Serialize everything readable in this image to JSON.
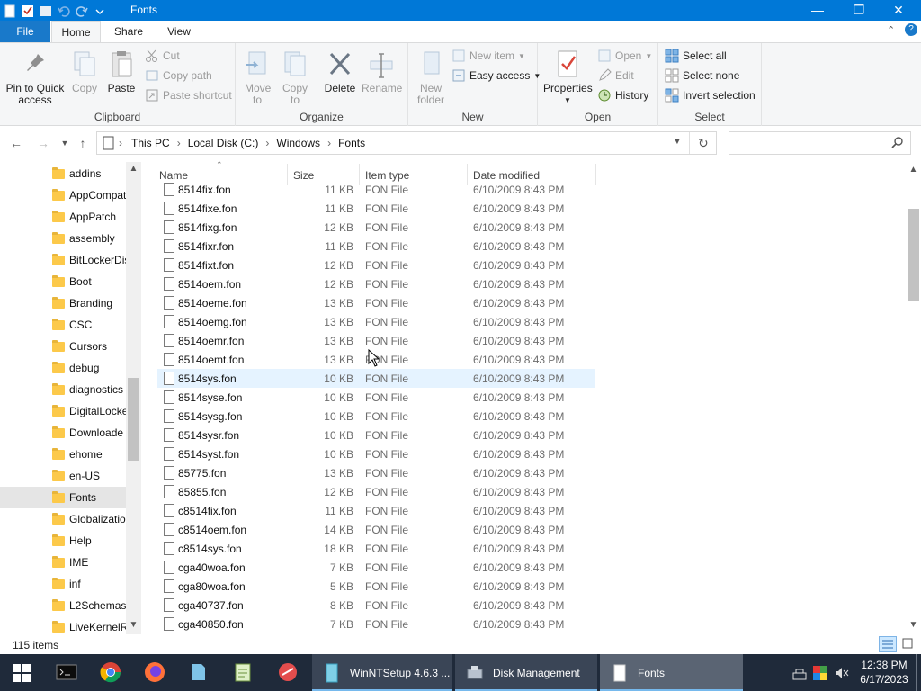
{
  "window": {
    "title": "Fonts"
  },
  "ribbon_tabs": {
    "file": "File",
    "home": "Home",
    "share": "Share",
    "view": "View"
  },
  "ribbon": {
    "clipboard": {
      "label": "Clipboard",
      "pin": "Pin to Quick access",
      "copy": "Copy",
      "paste": "Paste",
      "cut": "Cut",
      "copy_path": "Copy path",
      "paste_shortcut": "Paste shortcut"
    },
    "organize": {
      "label": "Organize",
      "move_to": "Move to",
      "copy_to": "Copy to",
      "delete": "Delete",
      "rename": "Rename"
    },
    "new": {
      "label": "New",
      "new_folder": "New folder",
      "new_item": "New item",
      "easy_access": "Easy access"
    },
    "open": {
      "label": "Open",
      "properties": "Properties",
      "open": "Open",
      "edit": "Edit",
      "history": "History"
    },
    "select": {
      "label": "Select",
      "select_all": "Select all",
      "select_none": "Select none",
      "invert": "Invert selection"
    }
  },
  "address": {
    "crumbs": [
      "This PC",
      "Local Disk (C:)",
      "Windows",
      "Fonts"
    ]
  },
  "search": {
    "placeholder": ""
  },
  "nav": {
    "items": [
      "addins",
      "AppCompat",
      "AppPatch",
      "assembly",
      "BitLockerDiscoveryVolumeContents",
      "Boot",
      "Branding",
      "CSC",
      "Cursors",
      "debug",
      "diagnostics",
      "DigitalLocker",
      "Downloaded",
      "ehome",
      "en-US",
      "Fonts",
      "Globalization",
      "Help",
      "IME",
      "inf",
      "L2Schemas",
      "LiveKernelReports"
    ],
    "display": [
      "addins",
      "AppCompat",
      "AppPatch",
      "assembly",
      "BitLockerDis",
      "Boot",
      "Branding",
      "CSC",
      "Cursors",
      "debug",
      "diagnostics",
      "DigitalLocke",
      "Downloade",
      "ehome",
      "en-US",
      "Fonts",
      "Globalizatio",
      "Help",
      "IME",
      "inf",
      "L2Schemas",
      "LiveKernelR"
    ]
  },
  "columns": {
    "name": "Name",
    "size": "Size",
    "type": "Item type",
    "date": "Date modified"
  },
  "files": [
    {
      "name": "8514fix.fon",
      "size": "11 KB",
      "type": "FON File",
      "date": "6/10/2009 8:43 PM"
    },
    {
      "name": "8514fixe.fon",
      "size": "11 KB",
      "type": "FON File",
      "date": "6/10/2009 8:43 PM"
    },
    {
      "name": "8514fixg.fon",
      "size": "12 KB",
      "type": "FON File",
      "date": "6/10/2009 8:43 PM"
    },
    {
      "name": "8514fixr.fon",
      "size": "11 KB",
      "type": "FON File",
      "date": "6/10/2009 8:43 PM"
    },
    {
      "name": "8514fixt.fon",
      "size": "12 KB",
      "type": "FON File",
      "date": "6/10/2009 8:43 PM"
    },
    {
      "name": "8514oem.fon",
      "size": "12 KB",
      "type": "FON File",
      "date": "6/10/2009 8:43 PM"
    },
    {
      "name": "8514oeme.fon",
      "size": "13 KB",
      "type": "FON File",
      "date": "6/10/2009 8:43 PM"
    },
    {
      "name": "8514oemg.fon",
      "size": "13 KB",
      "type": "FON File",
      "date": "6/10/2009 8:43 PM"
    },
    {
      "name": "8514oemr.fon",
      "size": "13 KB",
      "type": "FON File",
      "date": "6/10/2009 8:43 PM"
    },
    {
      "name": "8514oemt.fon",
      "size": "13 KB",
      "type": "FON File",
      "date": "6/10/2009 8:43 PM"
    },
    {
      "name": "8514sys.fon",
      "size": "10 KB",
      "type": "FON File",
      "date": "6/10/2009 8:43 PM"
    },
    {
      "name": "8514syse.fon",
      "size": "10 KB",
      "type": "FON File",
      "date": "6/10/2009 8:43 PM"
    },
    {
      "name": "8514sysg.fon",
      "size": "10 KB",
      "type": "FON File",
      "date": "6/10/2009 8:43 PM"
    },
    {
      "name": "8514sysr.fon",
      "size": "10 KB",
      "type": "FON File",
      "date": "6/10/2009 8:43 PM"
    },
    {
      "name": "8514syst.fon",
      "size": "10 KB",
      "type": "FON File",
      "date": "6/10/2009 8:43 PM"
    },
    {
      "name": "85775.fon",
      "size": "13 KB",
      "type": "FON File",
      "date": "6/10/2009 8:43 PM"
    },
    {
      "name": "85855.fon",
      "size": "12 KB",
      "type": "FON File",
      "date": "6/10/2009 8:43 PM"
    },
    {
      "name": "c8514fix.fon",
      "size": "11 KB",
      "type": "FON File",
      "date": "6/10/2009 8:43 PM"
    },
    {
      "name": "c8514oem.fon",
      "size": "14 KB",
      "type": "FON File",
      "date": "6/10/2009 8:43 PM"
    },
    {
      "name": "c8514sys.fon",
      "size": "18 KB",
      "type": "FON File",
      "date": "6/10/2009 8:43 PM"
    },
    {
      "name": "cga40woa.fon",
      "size": "7 KB",
      "type": "FON File",
      "date": "6/10/2009 8:43 PM"
    },
    {
      "name": "cga80woa.fon",
      "size": "5 KB",
      "type": "FON File",
      "date": "6/10/2009 8:43 PM"
    },
    {
      "name": "cga40737.fon",
      "size": "8 KB",
      "type": "FON File",
      "date": "6/10/2009 8:43 PM"
    },
    {
      "name": "cga40850.fon",
      "size": "7 KB",
      "type": "FON File",
      "date": "6/10/2009 8:43 PM"
    }
  ],
  "status": {
    "count": "115 items"
  },
  "taskbar": {
    "apps": [
      "WinNTSetup 4.6.3 ...",
      "Disk Management",
      "Fonts"
    ],
    "time": "12:38 PM",
    "date": "6/17/2023"
  },
  "colors": {
    "accent": "#0078d7",
    "hover_row": "#e5f3ff",
    "selected_nav": "#e5e5e5"
  }
}
